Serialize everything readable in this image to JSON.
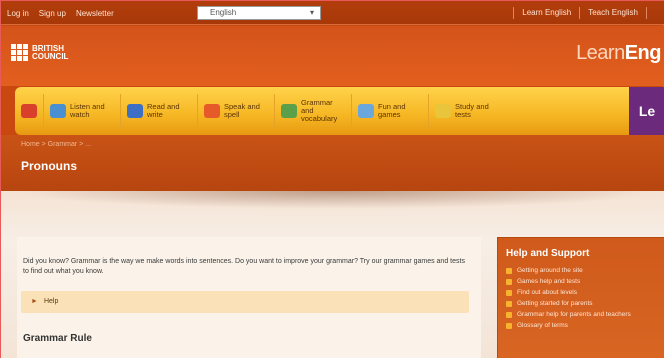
{
  "topbar": {
    "links": [
      "Log in",
      "Sign up",
      "Newsletter"
    ],
    "language_select": "English",
    "right_links": [
      "Learn English",
      "Teach English",
      ""
    ]
  },
  "header": {
    "logo_line1": "BRITISH",
    "logo_line2": "COUNCIL",
    "brand_light": "Learn",
    "brand_bold": "Eng"
  },
  "nav": {
    "items": [
      {
        "label": "",
        "icon": "home-icon",
        "color": "#d9402b"
      },
      {
        "label": "Listen and watch",
        "icon": "headphones-icon",
        "color": "#4a8fd1"
      },
      {
        "label": "Read and write",
        "icon": "book-icon",
        "color": "#3d6fc4"
      },
      {
        "label": "Speak and spell",
        "icon": "speech-icon",
        "color": "#e65a2a"
      },
      {
        "label": "Grammar and vocabulary",
        "icon": "grammar-icon",
        "color": "#5aa04a"
      },
      {
        "label": "Fun and games",
        "icon": "games-icon",
        "color": "#6aa7dc"
      },
      {
        "label": "Study and tests",
        "icon": "test-icon",
        "color": "#e8c53a"
      }
    ],
    "purple_label": "Le"
  },
  "band": {
    "breadcrumb": "Home > Grammar > ...",
    "page_title": "Pronouns"
  },
  "content": {
    "intro": "Did you know? Grammar is the way we make words into sentences. Do you want to improve your grammar? Try our grammar games and tests to find out what you know.",
    "help_label": "Help",
    "section_heading": "Grammar Rule"
  },
  "sidebar": {
    "title": "Help and Support",
    "items": [
      "Getting around the site",
      "Games help and tests",
      "Find out about levels",
      "Getting started for parents",
      "Grammar help for parents and teachers",
      "Glossary of terms"
    ]
  },
  "colors": {
    "header_orange": "#e25f1e",
    "nav_yellow": "#f6b623",
    "nav_purple": "#6b2a7c",
    "content_bg": "#f7eee6"
  }
}
